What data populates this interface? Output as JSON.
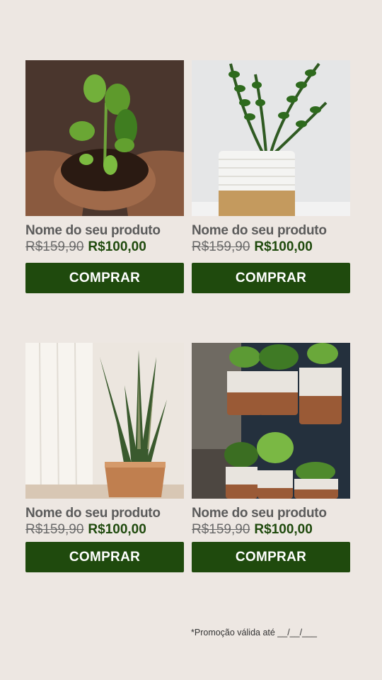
{
  "products": [
    {
      "name": "Nome do seu produto",
      "old_price": "R$159,90",
      "price": "R$100,00",
      "button_label": "COMPRAR",
      "image": "hands-holding-seedling-photo"
    },
    {
      "name": "Nome do seu produto",
      "old_price": "R$159,90",
      "price": "R$100,00",
      "button_label": "COMPRAR",
      "image": "zz-plant-in-woven-basket-photo"
    },
    {
      "name": "Nome do seu produto",
      "old_price": "R$159,90",
      "price": "R$100,00",
      "button_label": "COMPRAR",
      "image": "snake-plant-in-clay-pot-photo"
    },
    {
      "name": "Nome do seu produto",
      "old_price": "R$159,90",
      "price": "R$100,00",
      "button_label": "COMPRAR",
      "image": "wall-hanging-pots-photo"
    }
  ],
  "footer": {
    "note": "*Promoção válida até __/__/___"
  },
  "colors": {
    "background": "#ede7e2",
    "accent": "#1f4a0d",
    "text": "#5b5b5b"
  }
}
